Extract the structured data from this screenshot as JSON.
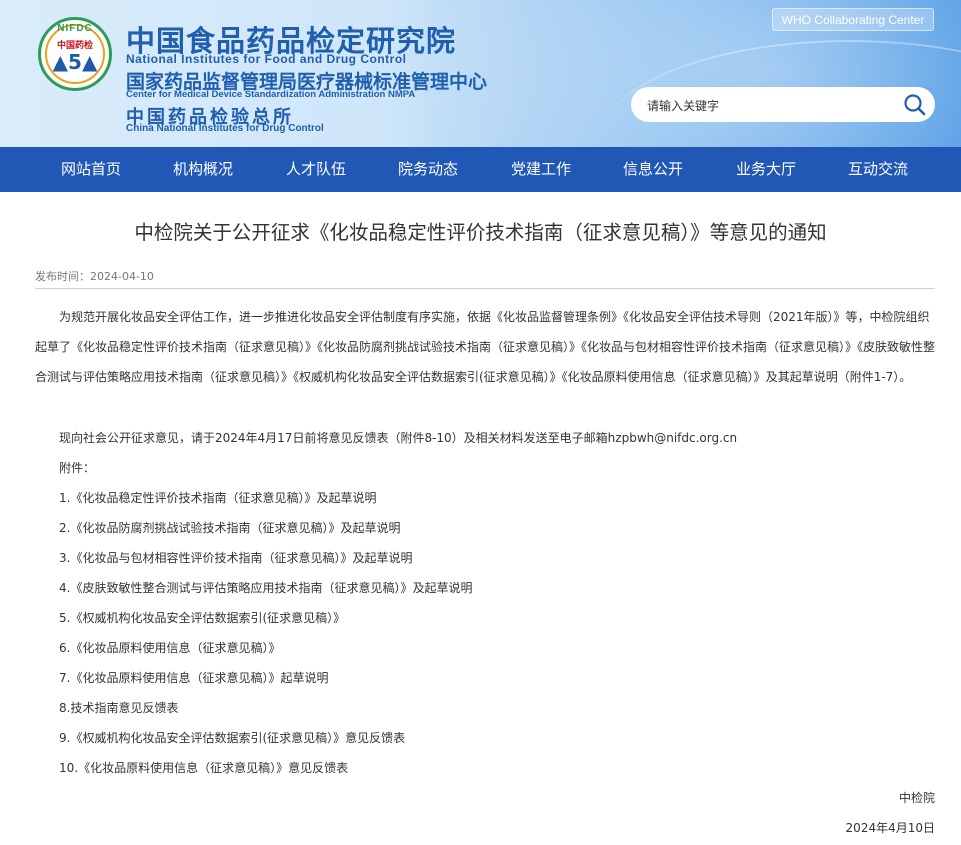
{
  "header": {
    "logo": {
      "top_text": "NIFDC",
      "mid_text": "中国药检"
    },
    "title_cn": "中国食品药品检定研究院",
    "title_en": "National Institutes for Food and Drug Control",
    "center_cn": "国家药品监督管理局医疗器械标准管理中心",
    "center_en": "Center for Medical Device Standardization Administration NMPA",
    "bureau_cn": "中国药品检验总所",
    "bureau_en": "China National Institutes for Drug Control",
    "who_label": "WHO Collaborating Center",
    "search_placeholder": "请输入关键字"
  },
  "nav": [
    "网站首页",
    "机构概况",
    "人才队伍",
    "院务动态",
    "党建工作",
    "信息公开",
    "业务大厅",
    "互动交流"
  ],
  "article": {
    "title": "中检院关于公开征求《化妆品稳定性评价技术指南（征求意见稿）》等意见的通知",
    "date_label": "发布时间：",
    "date": "2024-04-10",
    "para1": "为规范开展化妆品安全评估工作，进一步推进化妆品安全评估制度有序实施，依据《化妆品监督管理条例》《化妆品安全评估技术导则（2021年版）》等，中检院组织起草了《化妆品稳定性评价技术指南（征求意见稿）》《化妆品防腐剂挑战试验技术指南（征求意见稿）》《化妆品与包材相容性评价技术指南（征求意见稿）》《皮肤致敏性整合测试与评估策略应用技术指南（征求意见稿）》《权威机构化妆品安全评估数据索引(征求意见稿）》《化妆品原料使用信息（征求意见稿）》及其起草说明（附件1-7）。",
    "para2": "现向社会公开征求意见，请于2024年4月17日前将意见反馈表（附件8-10）及相关材料发送至电子邮箱hzpbwh@nifdc.org.cn",
    "attach_label": "附件：",
    "attachments": [
      "1.《化妆品稳定性评价技术指南（征求意见稿）》及起草说明",
      "2.《化妆品防腐剂挑战试验技术指南（征求意见稿）》及起草说明",
      "3.《化妆品与包材相容性评价技术指南（征求意见稿）》及起草说明",
      "4.《皮肤致敏性整合测试与评估策略应用技术指南（征求意见稿）》及起草说明",
      "5.《权威机构化妆品安全评估数据索引(征求意见稿）》",
      "6.《化妆品原料使用信息（征求意见稿）》",
      "7.《化妆品原料使用信息（征求意见稿）》起草说明",
      "8.技术指南意见反馈表",
      "9.《权威机构化妆品安全评估数据索引(征求意见稿）》意见反馈表",
      "10.《化妆品原料使用信息（征求意见稿）》意见反馈表"
    ],
    "signature": "中检院",
    "sign_date": "2024年4月10日"
  },
  "colors": {
    "nav_bg": "#2157b5",
    "brand_blue": "#1f5fae",
    "logo_green": "#2e9b56"
  }
}
